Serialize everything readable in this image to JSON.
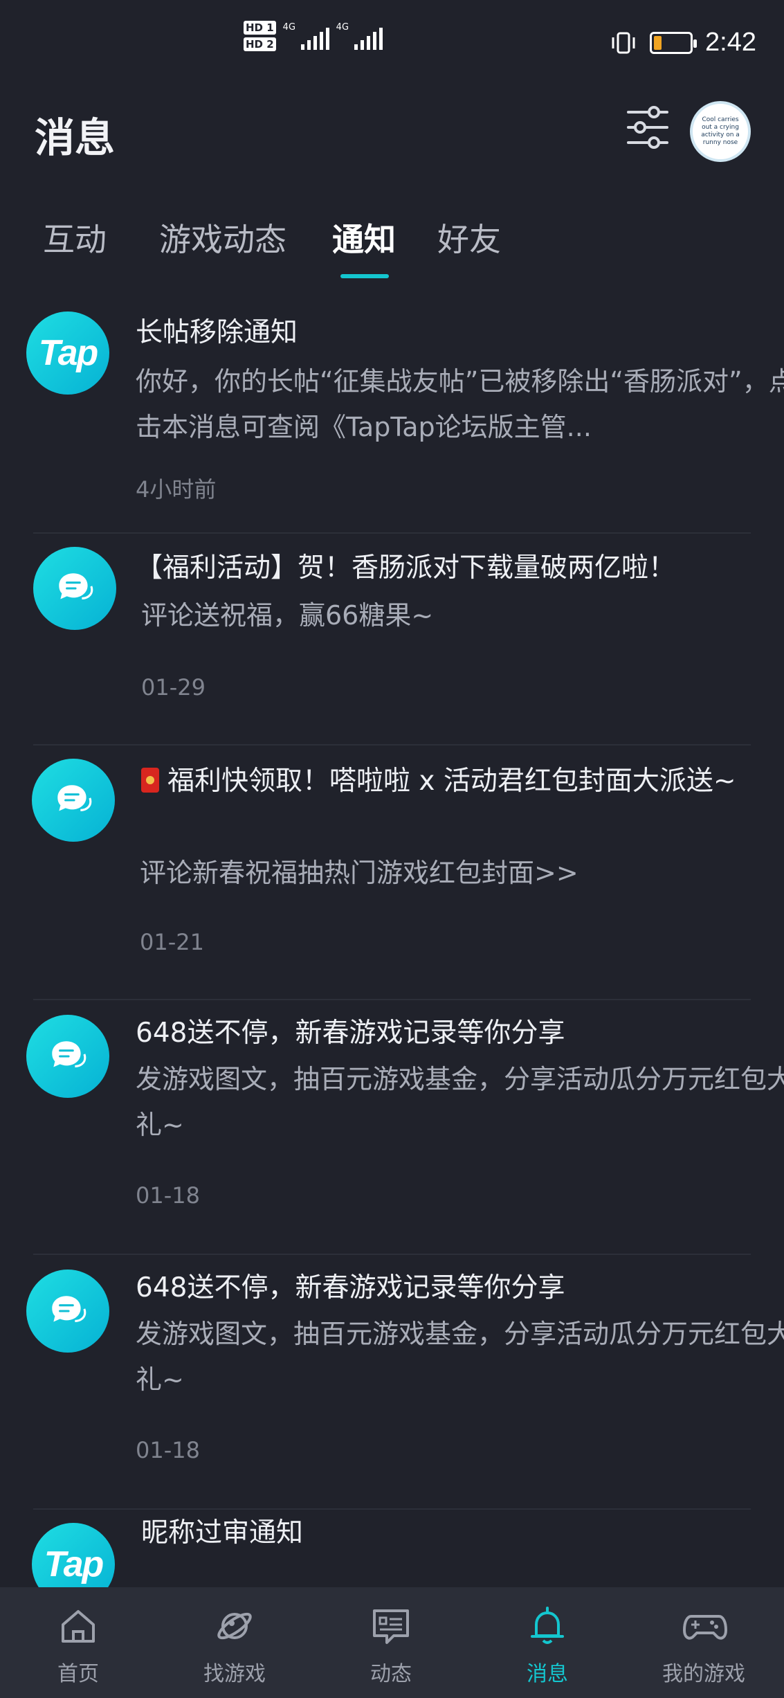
{
  "status_bar": {
    "hd1": "HD 1",
    "hd2": "HD 2",
    "net1": "4G",
    "net2": "4G",
    "time": "2:42",
    "battery_level": 0.22,
    "battery_color": "#f0a422"
  },
  "header": {
    "title": "消息",
    "filter_icon": "sliders-icon",
    "avatar_text": "Cool carries out a crying activity on a runny nose"
  },
  "tabs": [
    {
      "label": "互动",
      "active": false
    },
    {
      "label": "游戏动态",
      "active": false
    },
    {
      "label": "通知",
      "active": true
    },
    {
      "label": "好友",
      "active": false
    }
  ],
  "accent_color": "#14c6cf",
  "notifications": [
    {
      "icon": "taptap-logo-icon",
      "icon_text": "Tap",
      "title": "长帖移除通知",
      "body": "你好，你的长帖“征集战友帖”已被移除出“香肠派对”，点击本消息可查阅《TapTap论坛版主管...",
      "time": "4小时前"
    },
    {
      "icon": "chat-bubble-icon",
      "title": "【福利活动】贺！香肠派对下载量破两亿啦！",
      "body": "评论送祝福，赢66糖果~",
      "time": "01-29"
    },
    {
      "icon": "chat-bubble-icon",
      "title_emoji": "red-envelope-icon",
      "title": "福利快领取！嗒啦啦 x 活动君红包封面大派送~",
      "body": "评论新春祝福抽热门游戏红包封面>>",
      "time": "01-21"
    },
    {
      "icon": "chat-bubble-icon",
      "title": "648送不停，新春游戏记录等你分享",
      "body": "发游戏图文，抽百元游戏基金，分享活动瓜分万元红包大礼~",
      "time": "01-18"
    },
    {
      "icon": "chat-bubble-icon",
      "title": "648送不停，新春游戏记录等你分享",
      "body": "发游戏图文，抽百元游戏基金，分享活动瓜分万元红包大礼~",
      "time": "01-18"
    },
    {
      "icon": "taptap-logo-icon",
      "icon_text": "Tap",
      "title": "昵称过审通知"
    }
  ],
  "bottom_nav": [
    {
      "label": "首页",
      "icon": "home-icon",
      "active": false
    },
    {
      "label": "找游戏",
      "icon": "planet-icon",
      "active": false
    },
    {
      "label": "动态",
      "icon": "feed-icon",
      "active": false
    },
    {
      "label": "消息",
      "icon": "bell-icon",
      "active": true
    },
    {
      "label": "我的游戏",
      "icon": "gamepad-icon",
      "active": false
    }
  ]
}
